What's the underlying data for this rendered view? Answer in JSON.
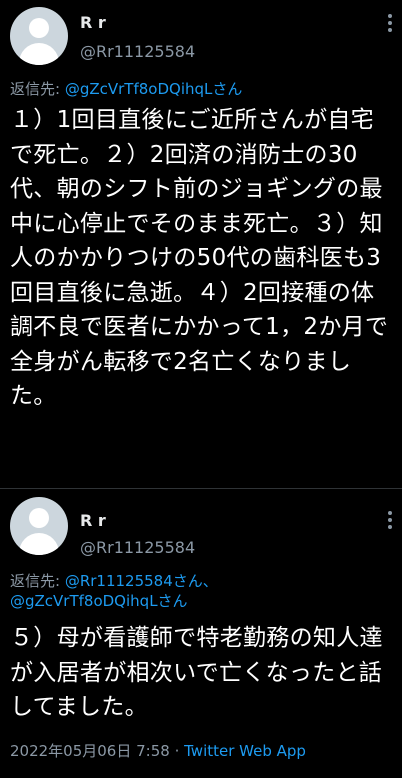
{
  "tweets": [
    {
      "name": "R r",
      "handle": "@Rr11125584",
      "replying_prefix": "返信先: ",
      "replying_to": [
        "@gZcVrTf8oDQihqLさん"
      ],
      "text": "１）1回目直後にご近所さんが自宅で死亡。２）2回済の消防士の30代、朝のシフト前のジョギングの最中に心停止でそのまま死亡。３）知人のかかりつけの50代の歯科医も3回目直後に急逝。４）2回接種の体調不良で医者にかかって1，2か月で全身がん転移で2名亡くなりました。"
    },
    {
      "name": "R r",
      "handle": "@Rr11125584",
      "replying_prefix": "返信先: ",
      "replying_to": [
        "@Rr11125584さん、",
        "@gZcVrTf8oDQihqLさん"
      ],
      "text": "５）母が看護師で特老勤務の知人達が入居者が相次いで亡くなったと話してました。",
      "timestamp": "2022年05月06日 7:58",
      "separator": " · ",
      "source_app": "Twitter Web App"
    }
  ],
  "colors": {
    "background": "#000000",
    "text": "#ffffff",
    "secondary": "#8b98a5",
    "link": "#1d9bf0",
    "divider": "#2f3336"
  }
}
